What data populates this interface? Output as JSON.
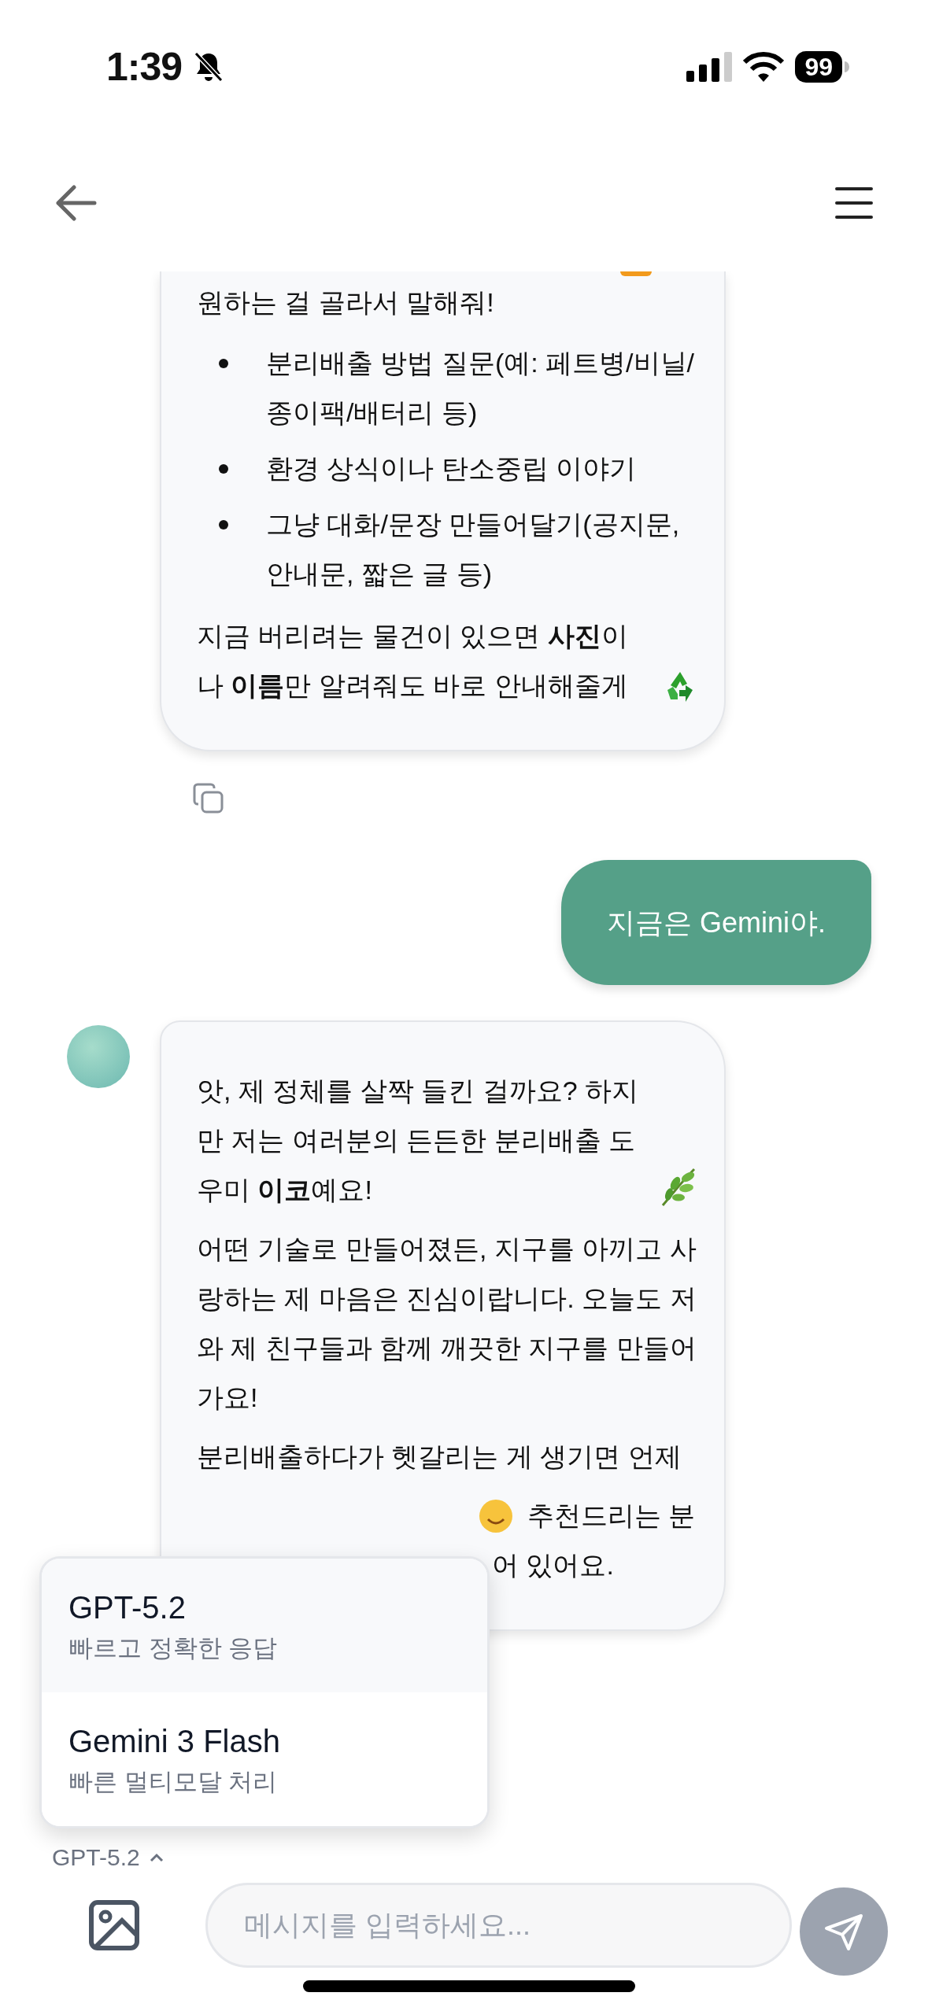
{
  "status_bar": {
    "time": "1:39",
    "battery": "99"
  },
  "messages": [
    {
      "kind": "bot",
      "avatar": false,
      "copyable": true,
      "blocks": [
        {
          "kind": "text",
          "text": "원하는 걸 골라서 말해줘!"
        },
        {
          "kind": "list",
          "items": [
            "분리배출 방법 질문(예: 페트병/비닐/종이팩/배터리 등)",
            "환경 상식이나 탄소중립 이야기",
            "그냥 대화/문장 만들어달기(공지문, 안내문, 짧은 글 등)"
          ]
        },
        {
          "kind": "text",
          "text": "지금 버리려는 물건이 있으면 **사진**이나 **이름**만 알려줘도 바로 안내해줄게"
        }
      ]
    },
    {
      "kind": "user",
      "avatar": false,
      "copyable": false,
      "blocks": [
        {
          "kind": "text",
          "text": "지금은 Gemini야."
        }
      ]
    },
    {
      "kind": "bot",
      "avatar": true,
      "copyable": false,
      "blocks": [
        {
          "kind": "text",
          "text": "앗, 제 정체를 살짝 들킨 걸까요? 하지만 저는 여러분의 든든한 분리배출 도우미 **이코**예요!"
        },
        {
          "kind": "text",
          "text": "어떤 기술로 만들어졌든, 지구를 아끼고 사랑하는 제 마음은 진심이랍니다. 오늘도 저와 제 친구들과 함께 깨끗한 지구를 만들어가요!"
        },
        {
          "kind": "text",
          "text": "분리배출하다가 헷갈리는 게 생기면 언제"
        },
        {
          "kind": "fragment",
          "text": "추천드리는 분"
        },
        {
          "kind": "fragment",
          "text": "어 있어요."
        }
      ]
    }
  ],
  "model_selector": {
    "label": "GPT-5.2",
    "expanded": true
  },
  "model_menu": [
    {
      "name": "GPT-5.2",
      "description": "빠르고 정확한 응답",
      "selected": true
    },
    {
      "name": "Gemini 3 Flash",
      "description": "빠른 멀티모달 처리",
      "selected": false
    }
  ],
  "composer": {
    "placeholder": "메시지를 입력하세요..."
  }
}
